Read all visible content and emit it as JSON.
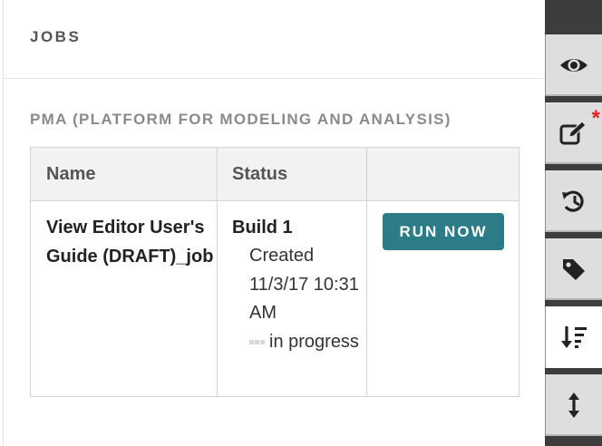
{
  "panel": {
    "title": "JOBS",
    "section_title": "PMA (PLATFORM FOR MODELING AND ANALYSIS)"
  },
  "table": {
    "columns": [
      "Name",
      "Status",
      ""
    ],
    "rows": [
      {
        "name": "View Editor User's Guide (DRAFT)_job",
        "build": "Build 1",
        "created": "Created 11/3/17 10:31 AM",
        "progress": "in progress",
        "action": "RUN NOW"
      }
    ]
  },
  "sidebar": {
    "tabs": [
      {
        "icon": "eye-icon",
        "active": false
      },
      {
        "icon": "edit-icon",
        "active": false,
        "badge": "*"
      },
      {
        "icon": "history-icon",
        "active": false
      },
      {
        "icon": "tag-icon",
        "active": false
      },
      {
        "icon": "sort-icon",
        "active": true
      },
      {
        "icon": "resize-vertical-icon",
        "active": false
      }
    ]
  },
  "colors": {
    "accent": "#2b7c87",
    "sidebar_bg": "#3d3d3d",
    "badge": "#e12222"
  }
}
